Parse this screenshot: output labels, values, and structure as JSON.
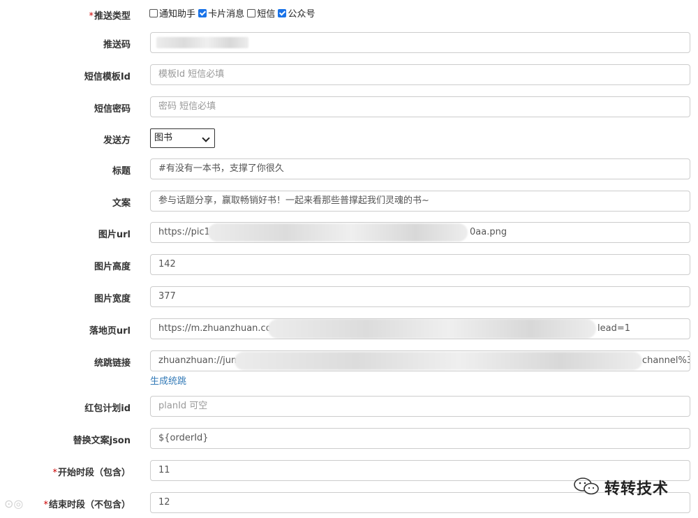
{
  "push_type": {
    "label": "推送类型",
    "options": [
      {
        "label": "通知助手",
        "checked": false
      },
      {
        "label": "卡片消息",
        "checked": true
      },
      {
        "label": "短信",
        "checked": false
      },
      {
        "label": "公众号",
        "checked": true
      }
    ]
  },
  "push_code": {
    "label": "推送码"
  },
  "sms_template": {
    "label": "短信模板Id",
    "placeholder": "模板Id 短信必填"
  },
  "sms_secret": {
    "label": "短信密码",
    "placeholder": "密码 短信必填"
  },
  "sender": {
    "label": "发送方",
    "value": "图书"
  },
  "title": {
    "label": "标题",
    "value": "#有没有一本书，支撑了你很久"
  },
  "copy": {
    "label": "文案",
    "value": "参与话题分享，赢取畅销好书！一起来看那些普撑起我们灵魂的书~"
  },
  "image_url": {
    "label": "图片url",
    "value_prefix": "https://pic1.z",
    "value_suffix": "0aa.png"
  },
  "image_height": {
    "label": "图片高度",
    "value": "142"
  },
  "image_width": {
    "label": "图片宽度",
    "value": "377"
  },
  "landing_url": {
    "label": "落地页url",
    "value_prefix": "https://m.zhuanzhuan.com",
    "value_suffix": "lead=1"
  },
  "unified_link": {
    "label": "统跳链接",
    "value_prefix": "zhuanzhuan://jump",
    "value_suffix": "channel%3",
    "generate_link": "生成统跳"
  },
  "red_packet": {
    "label": "红包计划id",
    "placeholder": "planId 可空"
  },
  "replace_json": {
    "label": "替换文案json",
    "value": "${orderId}"
  },
  "start_period": {
    "label": "开始时段（包含）",
    "value": "11"
  },
  "end_period": {
    "label": "结束时段（不包含）",
    "value": "12"
  },
  "watermark": {
    "text": "转转技术"
  }
}
